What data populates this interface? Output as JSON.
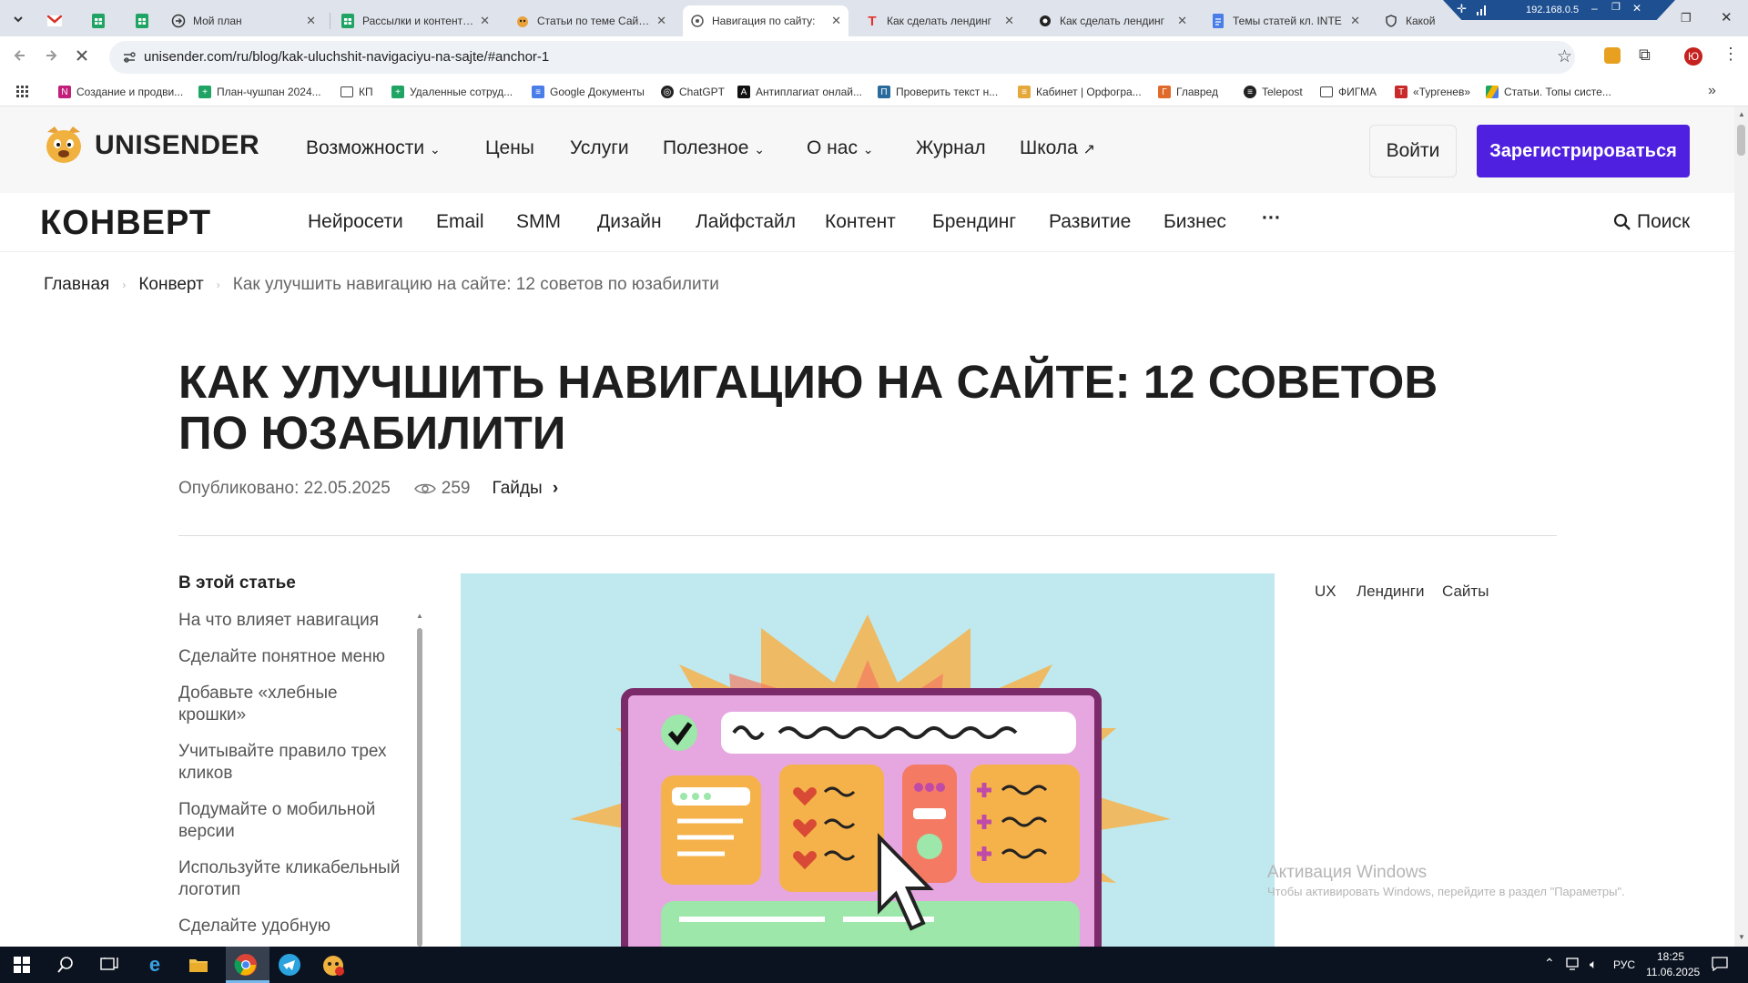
{
  "browser": {
    "tabs": [
      {
        "title": "",
        "active": false,
        "icon": "gmail-icon"
      },
      {
        "title": "",
        "active": false,
        "icon": "sheets-icon"
      },
      {
        "title": "",
        "active": false,
        "icon": "sheets-icon"
      },
      {
        "title": "Мой план",
        "active": false,
        "icon": "arrow-circle-icon"
      },
      {
        "title": "Рассылки и контент-...",
        "active": false,
        "icon": "sheets-icon"
      },
      {
        "title": "Статьи по теме Сайты",
        "active": false,
        "icon": "unisender-icon"
      },
      {
        "title": "Навигация по сайту:",
        "active": true,
        "icon": "unisender-icon"
      },
      {
        "title": "Как сделать лендинг",
        "active": false,
        "icon": "tilda-icon"
      },
      {
        "title": "Как сделать лендинг",
        "active": false,
        "icon": "chatgpt-icon"
      },
      {
        "title": "Темы статей кл. INTE",
        "active": false,
        "icon": "docs-icon"
      },
      {
        "title": "Какой",
        "active": false,
        "icon": "shield-icon"
      }
    ],
    "ip_overlay": "192.168.0.5",
    "url": "unisender.com/ru/blog/kak-uluchshit-navigaciyu-na-sajte/#anchor-1",
    "profile_initial": "Ю",
    "bookmarks": [
      "Создание и продви...",
      "План-чушпан 2024...",
      "КП",
      "Удаленные сотруд...",
      "Google Документы",
      "ChatGPT",
      "Антиплагиат онлай...",
      "Проверить текст н...",
      "Кабинет | Орфогра...",
      "Главред",
      "Telepost",
      "ФИГМА",
      "«Тургенев»",
      "Статьи. Топы систе..."
    ]
  },
  "site": {
    "logo_text": "UNISENDER",
    "nav": [
      "Возможности",
      "Цены",
      "Услуги",
      "Полезное",
      "О нас",
      "Журнал",
      "Школа"
    ],
    "login": "Войти",
    "signup": "Зарегистрироваться",
    "konvert": "КОНВЕРТ",
    "subnav": [
      "Нейросети",
      "Email",
      "SMM",
      "Дизайн",
      "Лайфстайл",
      "Контент",
      "Брендинг",
      "Развитие",
      "Бизнес"
    ],
    "more": "···",
    "search": "Поиск"
  },
  "breadcrumbs": [
    "Главная",
    "Конверт",
    "Как улучшить навигацию на сайте: 12 советов по юзабилити"
  ],
  "article": {
    "title": "КАК УЛУЧШИТЬ НАВИГАЦИЮ НА САЙТЕ: 12 СОВЕТОВ ПО ЮЗАБИЛИТИ",
    "published": "Опубликовано: 22.05.2025",
    "views": "259",
    "category": "Гайды"
  },
  "toc": {
    "heading": "В этой статье",
    "items": [
      "На что влияет навигация",
      "Сделайте понятное меню",
      "Добавьте «хлебные крошки»",
      "Учитывайте правило трех кликов",
      "Подумайте о мобильной версии",
      "Используйте кликабельный логотип",
      "Сделайте удобную"
    ]
  },
  "tags": [
    "UX",
    "Лендинги",
    "Сайты"
  ],
  "watermark": {
    "title": "Активация Windows",
    "subtitle": "Чтобы активировать Windows, перейдите в раздел \"Параметры\"."
  },
  "taskbar": {
    "lang": "РУС",
    "time": "18:25",
    "date": "11.06.2025"
  },
  "colors": {
    "accent": "#5020e0",
    "tab_strip": "#dfe3eb",
    "taskbar": "#0b1320"
  }
}
